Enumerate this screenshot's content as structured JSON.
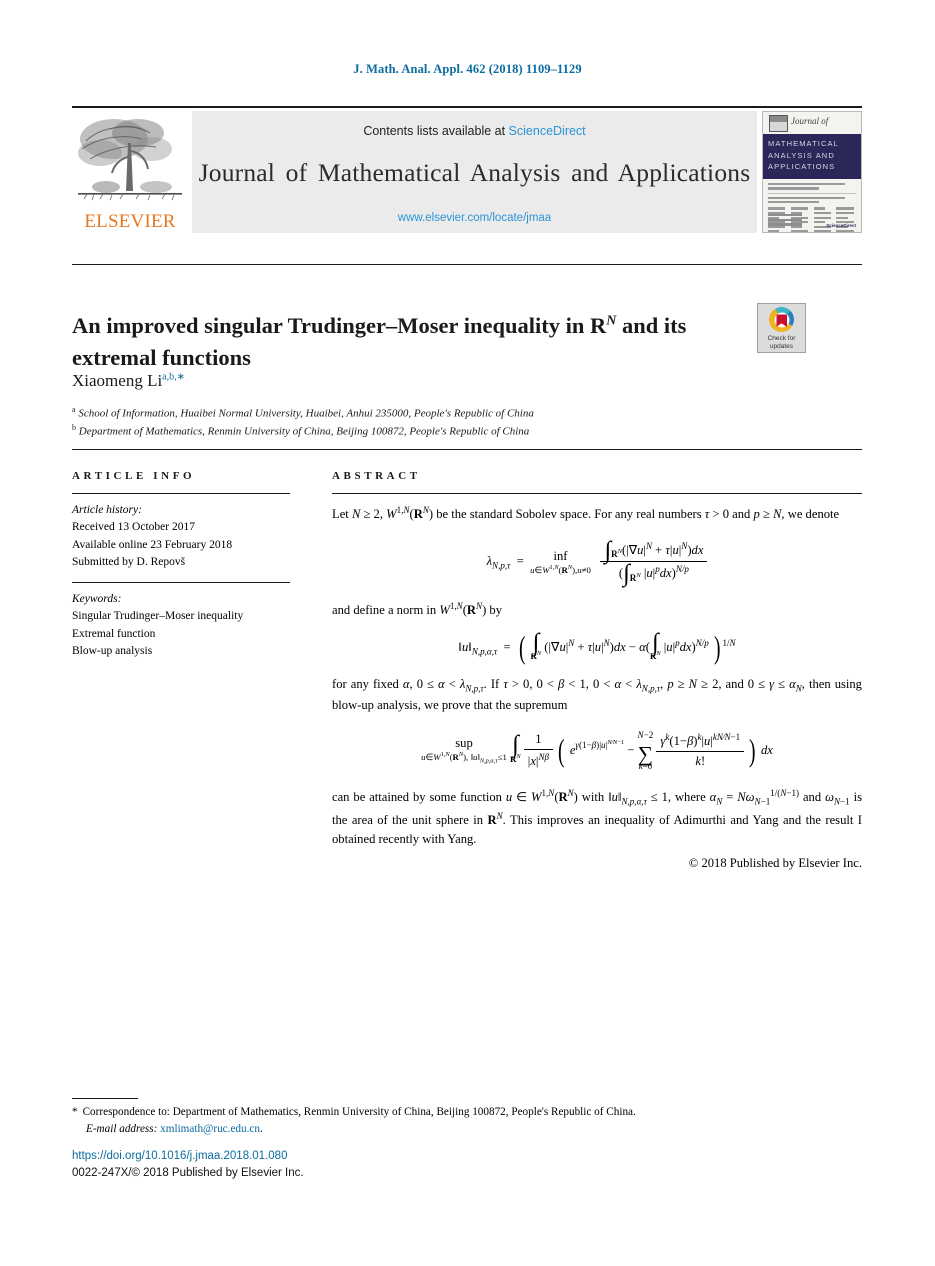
{
  "running_head": "J. Math. Anal. Appl. 462 (2018) 1109–1129",
  "masthead": {
    "contents_prefix": "Contents lists available at ",
    "sciencedirect": "ScienceDirect",
    "journal_title": "Journal of Mathematical  Analysis  and  Applications",
    "journal_url": "www.elsevier.com/locate/jmaa",
    "publisher_wordmark": "ELSEVIER",
    "cover": {
      "script_line": "Journal of",
      "band_line1": "MATHEMATICAL",
      "band_line2": "ANALYSIS AND",
      "band_line3": "APPLICATIONS",
      "footer_mark": "ScienceDirect"
    }
  },
  "article": {
    "title_part1": "An improved singular Trudinger–Moser inequality in ",
    "title_rn": "R",
    "title_rn_sup": "N",
    "title_part2": " and its extremal functions",
    "author": "Xiaomeng Li",
    "author_marks": "a,b,∗",
    "affiliation_a_mark": "a",
    "affiliation_a": "School of Information, Huaibei Normal University, Huaibei, Anhui 235000, People's Republic of China",
    "affiliation_b_mark": "b",
    "affiliation_b": "Department of Mathematics, Renmin University of China, Beijing 100872, People's Republic of China"
  },
  "crossmark": {
    "line1": "Check for",
    "line2": "updates"
  },
  "info": {
    "heading": "ARTICLE INFO",
    "history_label": "Article history:",
    "received": "Received 13 October 2017",
    "available": "Available online 23 February 2018",
    "submitted": "Submitted by D. Repovš",
    "keywords_label": "Keywords:",
    "keywords": [
      "Singular Trudinger–Moser inequality",
      "Extremal function",
      "Blow-up analysis"
    ]
  },
  "abstract": {
    "heading": "ABSTRACT",
    "para1_a": "Let ",
    "para1_b": "N ≥ 2, W",
    "para1_c": "1,N",
    "para1_d": "(R",
    "para1_e": "N",
    "para1_f": ") be the standard Sobolev space. For any real numbers ",
    "para1_g": "τ > 0",
    "para1_h": " and ",
    "para1_i": "p ≥ N",
    "para1_j": ", we denote",
    "eq1": {
      "lhs": "λ",
      "lhs_sub": "N,p,τ",
      "eq": "=",
      "inf_top": "inf",
      "inf_bot": "u∈W1,N(RN), u≠0",
      "num": "∫RN (|∇u|N + τ|u|N)dx",
      "den": "(∫RN |u|p dx)N/p"
    },
    "para2": "and define a norm in W1,N(RN) by",
    "eq2": {
      "lhs": "‖u‖",
      "lhs_sub": "N,p,α,τ",
      "body": "( ∫RN (|∇u|N + τ|u|N)dx − α( ∫RN |u|p dx)N/p )",
      "exp": "1/N"
    },
    "para3": "for any fixed α, 0 ≤ α < λN,p,τ. If τ > 0, 0 < β < 1, 0 < α < λN,p,τ, p ≥ N ≥ 2, and 0 ≤ γ ≤ αN, then using blow-up analysis, we prove that the supremum",
    "eq3": {
      "sup_top": "sup",
      "sup_bot": "u∈W1,N(RN), ‖u‖N,p,α,τ ≤1",
      "integral": "∫RN",
      "frac_num": "1",
      "frac_den": "|x|Nβ",
      "exp_term": "eγ(1−β)|u|N/(N−1)",
      "minus": "−",
      "sum_top": "N−2",
      "sum_bot": "k=0",
      "sum_num": "γk(1−β)k|u|kN/(N−1)",
      "sum_den": "k!",
      "dx": "dx"
    },
    "para4": "can be attained by some function u ∈ W1,N(RN) with ‖u‖N,p,α,τ ≤ 1, where αN = NωN−11/(N−1) and ωN−1 is the area of the unit sphere in RN. This improves an inequality of Adimurthi and Yang and the result I obtained recently with Yang.",
    "copyright": "© 2018 Published by Elsevier Inc."
  },
  "footer": {
    "corr_star": "*",
    "corr_text": "Correspondence to: Department of Mathematics, Renmin University of China, Beijing 100872, People's Republic of China.",
    "email_label": "E-mail address:",
    "email": "xmlimath@ruc.edu.cn",
    "email_period": ".",
    "doi": "https://doi.org/10.1016/j.jmaa.2018.01.080",
    "issn_line": "0022-247X/© 2018 Published by Elsevier Inc."
  },
  "colors": {
    "link": "#0b6ca0",
    "sciencedirect": "#2a93d5",
    "elsevier_orange": "#E87722",
    "cover_navy": "#2b2758"
  }
}
